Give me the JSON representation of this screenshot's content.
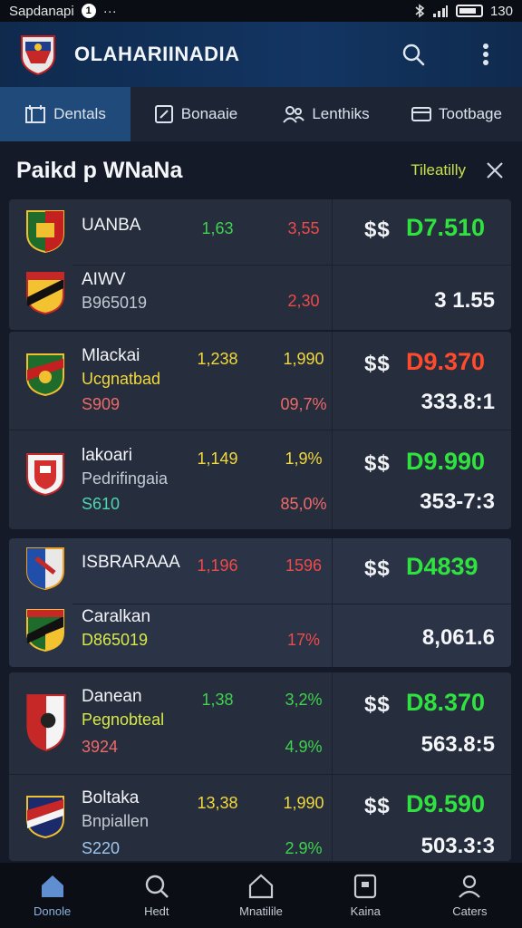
{
  "status": {
    "carrier": "Sapdanapi",
    "badge": "1",
    "dots": "···",
    "time": "130"
  },
  "header": {
    "title": "OLAHARIINADIA"
  },
  "tabs": [
    {
      "label": "Dentals",
      "icon": "calendar-icon",
      "active": true
    },
    {
      "label": "Bonaaie",
      "icon": "edit-icon",
      "active": false
    },
    {
      "label": "Lenthiks",
      "icon": "users-icon",
      "active": false
    },
    {
      "label": "Tootbage",
      "icon": "card-icon",
      "active": false
    }
  ],
  "section": {
    "title": "Paikd p WNaNa",
    "action": "Tileatilly"
  },
  "cards": [
    {
      "rows": [
        {
          "name": "UANBA",
          "odd1": "1,63",
          "odd2": "3,55",
          "currency": "$$",
          "price": "D7.510"
        },
        {
          "name": "AIWV",
          "code": "B965019",
          "odd2": "2,30",
          "price2": "3 1.55"
        }
      ]
    },
    {
      "rows": [
        {
          "name": "Mlackai",
          "sub": "Ucgnatbad",
          "code": "S909",
          "odd1": "1,238",
          "odd2": "1,990",
          "pct": "09,7%",
          "currency": "$$",
          "price": "D9.370",
          "price2": "333.8:1"
        },
        {
          "name": "lakoari",
          "sub": "Pedrifingaia",
          "code": "S610",
          "odd1": "1,149",
          "odd2": "1,9%",
          "pct": "85,0%",
          "currency": "$$",
          "price": "D9.990",
          "price2": "353-7:3"
        }
      ]
    },
    {
      "rows": [
        {
          "name": "ISBRARAAA",
          "odd1": "1,196",
          "odd2": "1596",
          "currency": "$$",
          "price": "D4839"
        },
        {
          "name": "Caralkan",
          "code": "D865019",
          "pct": "17%",
          "price2": "8,061.6"
        }
      ]
    },
    {
      "rows": [
        {
          "name": "Danean",
          "sub": "Pegnobteal",
          "code": "3924",
          "odd1": "1,38",
          "odd2": "3,2%",
          "pct": "4.9%",
          "currency": "$$",
          "price": "D8.370",
          "price2": "563.8:5"
        },
        {
          "name": "Boltaka",
          "sub": "Bnpiallen",
          "code": "S220",
          "odd1": "13,38",
          "odd2": "1,990",
          "pct": "2.9%",
          "currency": "$$",
          "price": "D9.590",
          "price2": "503.3:3"
        }
      ]
    }
  ],
  "nav": [
    {
      "label": "Donole",
      "icon": "home-icon",
      "active": true
    },
    {
      "label": "Hedt",
      "icon": "search-icon",
      "active": false
    },
    {
      "label": "Mnatilile",
      "icon": "house-outline-icon",
      "active": false
    },
    {
      "label": "Kaina",
      "icon": "square-icon",
      "active": false
    },
    {
      "label": "Caters",
      "icon": "user-icon",
      "active": false
    }
  ],
  "colors": {
    "accent": "#1f4a79",
    "green": "#3fd34f",
    "red": "#ef4a4a",
    "yellow": "#f2d93c"
  }
}
